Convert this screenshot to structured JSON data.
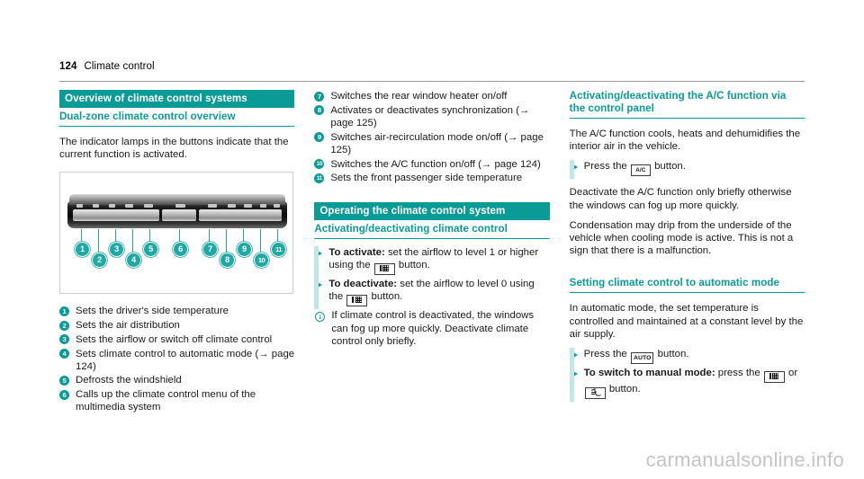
{
  "header": {
    "page_number": "124",
    "chapter": "Climate control"
  },
  "left_column": {
    "heading_main": "Overview of climate control systems",
    "heading_sub": "Dual-zone climate control overview",
    "intro": "The indicator lamps in the buttons indicate that the current function is activated.",
    "figure": {
      "name": "dual-zone-climate-control-panel",
      "callouts": [
        "1",
        "2",
        "3",
        "4",
        "5",
        "6",
        "7",
        "8",
        "9",
        "10",
        "11"
      ]
    },
    "legend": [
      {
        "num": "1",
        "text": "Sets the driver's side temperature"
      },
      {
        "num": "2",
        "text": "Sets the air distribution"
      },
      {
        "num": "3",
        "text": "Sets the airflow or switch off climate control"
      },
      {
        "num": "4",
        "text": "Sets climate control to automatic mode (→ page 124)"
      },
      {
        "num": "5",
        "text": "Defrosts the windshield"
      },
      {
        "num": "6",
        "text": "Calls up the climate control menu of the multimedia system"
      }
    ]
  },
  "middle_column": {
    "legend": [
      {
        "num": "7",
        "text": "Switches the rear window heater on/off"
      },
      {
        "num": "8",
        "text": "Activates or deactivates synchronization (→ page 125)"
      },
      {
        "num": "9",
        "text": "Switches air-recirculation mode on/off (→ page 125)"
      },
      {
        "num": "10",
        "text": "Switches the A/C function on/off (→ page 124)"
      },
      {
        "num": "11",
        "text": "Sets the front passenger side temperature"
      }
    ],
    "heading_main": "Operating the climate control system",
    "heading_sub": "Activating/deactivating climate control",
    "step_activate_label": "To activate:",
    "step_activate_text_before": " set the airflow to level 1 or higher using the ",
    "step_activate_text_after": " button.",
    "step_deactivate_label": "To deactivate:",
    "step_deactivate_text_before": " set the airflow to level 0 using the ",
    "step_deactivate_text_after": " button.",
    "note_text": "If climate control is deactivated, the windows can fog up more quickly. Deactivate climate control only briefly."
  },
  "right_column": {
    "heading_ac": "Activating/deactivating the A/C function via the control panel",
    "para_ac_1": "The A/C function cools, heats and dehumidifies the interior air in the vehicle.",
    "step_press_before": "Press the ",
    "step_press_after": " button.",
    "para_ac_2": "Deactivate the A/C function only briefly otherwise the windows can fog up more quickly.",
    "para_ac_3": "Condensation may drip from the underside of the vehicle when cooling mode is active. This is not a sign that there is a malfunction.",
    "heading_auto": "Setting climate control to automatic mode",
    "para_auto": "In automatic mode, the set temperature is controlled and maintained at a constant level by the air supply.",
    "step_auto_before": "Press the ",
    "step_auto_after": " button.",
    "step_manual_label": "To switch to manual mode:",
    "step_manual_before": " press the ",
    "step_manual_middle": " or ",
    "step_manual_after": " button."
  },
  "glyphs": {
    "ac_button": "A/C",
    "auto_button": "AUTO",
    "fan_button": "fan-level-icon",
    "distribution_button": "air-distribution-icon"
  },
  "watermark": "carmanualsonline.info",
  "colors": {
    "teal": "#0b9b96",
    "teal_light": "#bfe7e8",
    "callout": "#1fa9a5",
    "text": "#1a1a1a",
    "watermark": "#c4c4c4"
  }
}
